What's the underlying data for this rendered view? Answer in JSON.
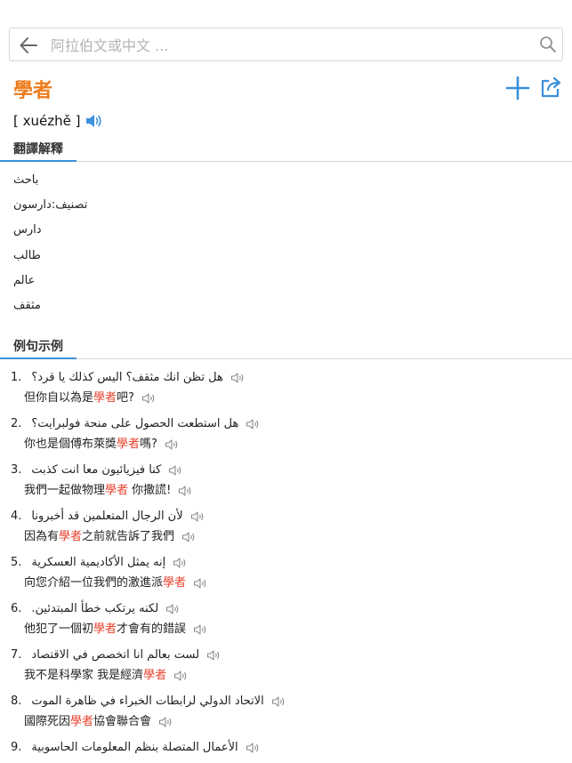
{
  "search": {
    "placeholder": "阿拉伯文或中文 ...",
    "value": ""
  },
  "entry": {
    "word": "學者",
    "pinyin": "[ xuézhě ]"
  },
  "colors": {
    "accent_orange": "#ee7b1b",
    "accent_blue": "#3c8fdc",
    "highlight_red": "#e8412c"
  },
  "icons": {
    "back": "arrow-left-icon",
    "search": "magnifier-icon",
    "add": "plus-icon",
    "share": "share-icon",
    "speaker": "speaker-icon"
  },
  "sections": {
    "translation": "翻譯解釋",
    "examples": "例句示例"
  },
  "translations": [
    "باحث",
    "تصنيف:دارسون",
    "دارس",
    "طالب",
    "عالم",
    "مثقف"
  ],
  "examples": [
    {
      "num": "1.",
      "ar": "هل تظن انك مثقف؟ اليس كذلك يا قرد؟",
      "zh_before": "但你自以為是",
      "zh_hl": "學者",
      "zh_after": "吧?"
    },
    {
      "num": "2.",
      "ar": "هل استطعت الحصول على منحة فولبرايت؟",
      "zh_before": "你也是個傅布萊獎",
      "zh_hl": "學者",
      "zh_after": "嗎?"
    },
    {
      "num": "3.",
      "ar": "كنا فيزيائيون معا انت كذبت",
      "zh_before": "我們一起做物理",
      "zh_hl": "學者",
      "zh_after": " 你撒謊!"
    },
    {
      "num": "4.",
      "ar": "لأن الرجال المتعلمين قد أخبرونا",
      "zh_before": "因為有",
      "zh_hl": "學者",
      "zh_after": "之前就告訴了我們"
    },
    {
      "num": "5.",
      "ar": "إنه يمثل الأكاديمية العسكرية",
      "zh_before": "向您介紹一位我們的激進派",
      "zh_hl": "學者",
      "zh_after": ""
    },
    {
      "num": "6.",
      "ar": "لكنه يرتكب خطأ المبتدئين.",
      "zh_before": "他犯了一個初",
      "zh_hl": "學者",
      "zh_after": "才會有的錯誤"
    },
    {
      "num": "7.",
      "ar": "لست بعالم انا اتخصص في الاقتصاد",
      "zh_before": "我不是科學家 我是經濟",
      "zh_hl": "學者",
      "zh_after": ""
    },
    {
      "num": "8.",
      "ar": "الاتحاد الدولي لرابطات الخبراء في ظاهرة الموت",
      "zh_before": "國際死因",
      "zh_hl": "學者",
      "zh_after": "協會聯合會"
    },
    {
      "num": "9.",
      "ar": "الأعمال المتصلة بنظم المعلومات الحاسوبية",
      "zh_before": "",
      "zh_hl": "",
      "zh_after": ""
    }
  ]
}
